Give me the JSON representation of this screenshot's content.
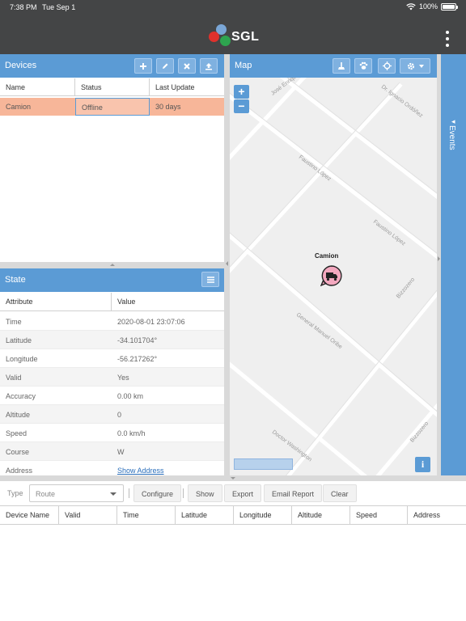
{
  "status_bar": {
    "time": "7:38 PM",
    "date": "Tue Sep 1",
    "battery": "100%",
    "battery_level": 1.0
  },
  "app": {
    "logo_text": "SGL",
    "colors": {
      "accent": "#5b9bd5",
      "header": "#444546",
      "selected_row": "#f7b699"
    }
  },
  "devices": {
    "title": "Devices",
    "tools": [
      "add-icon",
      "edit-icon",
      "remove-icon",
      "upload-icon"
    ],
    "columns": [
      "Name",
      "Status",
      "Last Update"
    ],
    "rows": [
      {
        "name": "Camion",
        "status": "Offline",
        "last_update": "30 days"
      }
    ]
  },
  "state": {
    "title": "State",
    "columns": [
      "Attribute",
      "Value"
    ],
    "rows": [
      {
        "attr": "Time",
        "value": "2020-08-01 23:07:06"
      },
      {
        "attr": "Latitude",
        "value": "-34.101704°"
      },
      {
        "attr": "Longitude",
        "value": "-56.217262°"
      },
      {
        "attr": "Valid",
        "value": "Yes"
      },
      {
        "attr": "Accuracy",
        "value": "0.00 km"
      },
      {
        "attr": "Altitude",
        "value": "0"
      },
      {
        "attr": "Speed",
        "value": "0.0 km/h"
      },
      {
        "attr": "Course",
        "value": "W"
      },
      {
        "attr": "Address",
        "value": "Show Address"
      }
    ]
  },
  "map": {
    "title": "Map",
    "zoom_in": "+",
    "zoom_out": "−",
    "marker_label": "Camion",
    "info": "i",
    "streets": [
      "José Enrique Rodó",
      "Faustino López",
      "Faustino López",
      "Bizzozero",
      "General Manuel Oribe",
      "Dr. Ignacio Ordóñez",
      "Doctor Washington",
      "Bizzozero"
    ]
  },
  "events": {
    "title": "Events"
  },
  "report": {
    "type_label": "Type",
    "type_placeholder": "Route",
    "buttons": [
      "Configure",
      "Show",
      "Export",
      "Email Report",
      "Clear"
    ],
    "columns": [
      "Device Name",
      "Valid",
      "Time",
      "Latitude",
      "Longitude",
      "Altitude",
      "Speed",
      "Address"
    ]
  }
}
